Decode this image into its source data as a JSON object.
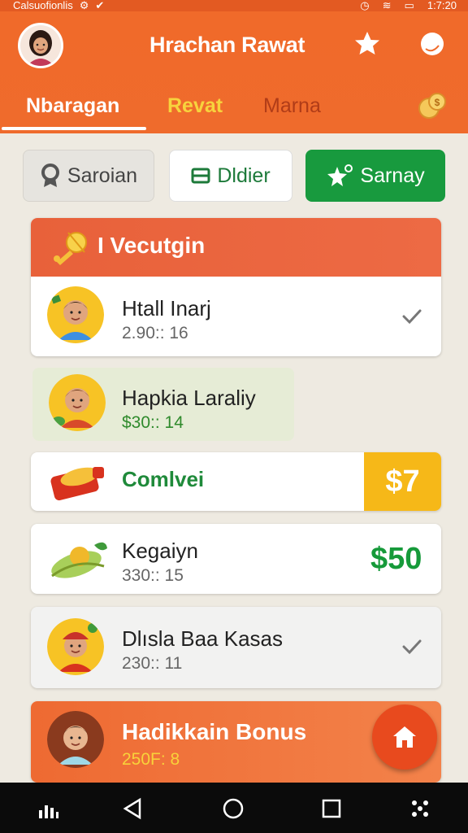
{
  "status": {
    "carrier": "Calsuofionlis",
    "time": "1:7:20"
  },
  "header": {
    "title": "Hrachan Rawat"
  },
  "tabs": [
    {
      "label": "Nbaragan"
    },
    {
      "label": "Revat"
    },
    {
      "label": "Marna"
    }
  ],
  "filters": [
    {
      "label": "Saroian",
      "icon": "badge-icon"
    },
    {
      "label": "Dldier",
      "icon": "wallet-icon"
    },
    {
      "label": "Sarnay",
      "icon": "sparkle-icon"
    }
  ],
  "section": {
    "title": "I Vecutgin",
    "icon": "trophy-icon"
  },
  "items": [
    {
      "name": "Htall Inarj",
      "sub": "2.90:: 16"
    },
    {
      "name": "Hapkia Laraliy",
      "sub": "$30:: 14"
    },
    {
      "name": "Comlvei",
      "amount": "$7"
    },
    {
      "name": "Kegaiyn",
      "sub": "330:: 15",
      "amount": "$50"
    },
    {
      "name": "Dlısla Baa Kasas",
      "sub": "230:: 11"
    },
    {
      "name": "Hadikkain Bonus",
      "sub": "250F: 8"
    }
  ],
  "colors": {
    "primary": "#ef6b2c",
    "green": "#189a3e",
    "gold": "#f6b818",
    "nav": "#0b0b0b"
  }
}
